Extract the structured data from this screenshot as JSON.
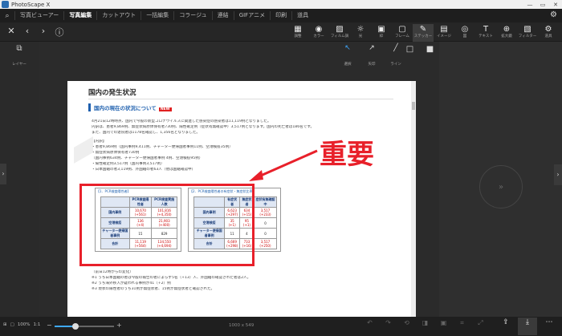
{
  "app": {
    "title": "PhotoScape X",
    "win_min": "—",
    "win_max": "▭",
    "win_close": "✕"
  },
  "tabs": [
    "写真ビューアー",
    "写真編集",
    "カットアウト",
    "一括編集",
    "コラージュ",
    "連結",
    "GIFアニメ",
    "印刷",
    "道具"
  ],
  "active_tab": 1,
  "nav": {
    "close": "✕",
    "back": "‹",
    "forward": "›",
    "info": "ⓘ"
  },
  "tools": [
    {
      "label": "調整",
      "icon": "adjust-icon",
      "glyph": "▦"
    },
    {
      "label": "カラー",
      "icon": "color-icon",
      "glyph": "◉"
    },
    {
      "label": "フィルム調",
      "icon": "film-icon",
      "glyph": "▨"
    },
    {
      "label": "光",
      "icon": "light-icon",
      "glyph": "☼"
    },
    {
      "label": "枠",
      "icon": "frame-icon",
      "glyph": "▣"
    },
    {
      "label": "フレーム",
      "icon": "frame2-icon",
      "glyph": "▢"
    },
    {
      "label": "ステッカー",
      "icon": "sticker-icon",
      "glyph": "✎"
    },
    {
      "label": "イメージ",
      "icon": "image-icon",
      "glyph": "▤"
    },
    {
      "label": "図",
      "icon": "shape-icon",
      "glyph": "◎"
    },
    {
      "label": "テキスト",
      "icon": "text-icon",
      "glyph": "T"
    },
    {
      "label": "拡大鏡",
      "icon": "magnifier-icon",
      "glyph": "⊕"
    },
    {
      "label": "フィルター",
      "icon": "filter-icon",
      "glyph": "▧"
    },
    {
      "label": "道具",
      "icon": "tools-icon",
      "glyph": "⚙"
    }
  ],
  "active_tool": 6,
  "layer_label": "レイヤー",
  "subtools": [
    {
      "label": "選択",
      "glyph": "↖"
    },
    {
      "label": "矢印",
      "glyph": "↗"
    },
    {
      "label": "ライン",
      "glyph": "╱"
    }
  ],
  "shapes": [
    "□",
    "■",
    "▢",
    "▣",
    "○",
    "●",
    "☆"
  ],
  "document": {
    "heading": "国内の発生状況",
    "subheading": "国内の現在の状況について",
    "new_badge": "NEW",
    "lines": [
      "4月21日12時時点、国内で今般の新型コロナウイルスに関連した感染症の感染者は11,119例となりました。",
      "内訳は、患者9,869例、無症状病原体保有者730例、陽性確定例（症状有無確認中）3,517例となります。国内の死亡者は186名です。",
      "また、国内での退院者は1178名確認し、1,356名となりました。",
      "【内訳】",
      "・患者9,869例（国内事例9,411例、チャーター便帰国者事例11例、空港検疫35例）",
      "・無症状病原体保有者730例",
      "（国内事例634例、チャーター便帰国者事例 4例、空港検疫95例）",
      "・陽性確定例3,517例（国内事例3,517例）",
      "・日本国籍の者3,119例、外国籍の者63人（他は国籍確認中）"
    ],
    "bottom_lines": [
      "（前日12時からの変化）",
      "※1 うち日本国籍の者は今般の報告の者によらず5名（+13）人、外国籍の確認された者は2人。",
      "※2 うち海外移入が疑われる事例が41（+2）例",
      "※3 現状の陽性者のうち31例が無症状者、15例が無症状者と確認された。"
    ],
    "table1": {
      "caption": "【1．PCR検査陽性者】",
      "headers": [
        "",
        "PCR検査陽性者",
        "PCR検査実施人数"
      ],
      "rows": [
        [
          "国内事例",
          "10,670\n(+561)",
          "101,816\n(+4,350)"
        ],
        [
          "空港検疫",
          "136\n(+4)",
          "21,903\n(+400)"
        ],
        [
          "チャーター便帰国者事例",
          "15",
          "829"
        ],
        [
          "合計",
          "11,119\n(+564)",
          "134,550\n(+4,694)"
        ]
      ]
    },
    "table2": {
      "caption": "【2．PCR検査陽性者の有症状・無症状比率】",
      "headers": [
        "",
        "有症状者",
        "無症状者",
        "症状有無確認中"
      ],
      "rows": [
        [
          "国内事例",
          "6,623\n(+297)",
          "634\n(+15)",
          "3,517\n(+233)"
        ],
        [
          "空港検疫",
          "35\n(+1)",
          "95\n(+1)",
          "0"
        ],
        [
          "チャーター便帰国者事例",
          "11",
          "4",
          "0"
        ],
        [
          "合計",
          "6,669\n(+298)",
          "733\n(+16)",
          "3,517\n(+250)"
        ]
      ]
    }
  },
  "annotation": {
    "text": "重要"
  },
  "status": {
    "zoom": "100%",
    "ratio": "1:1",
    "zoom_minus": "−",
    "zoom_plus": "+",
    "zoom_level": 0.35,
    "image_size": "1000 x 549"
  },
  "bottom_tools": [
    {
      "label": "元に戻す",
      "glyph": "↶"
    },
    {
      "label": "やり直し",
      "glyph": "↷"
    },
    {
      "label": "元に戻す",
      "glyph": "⟲"
    },
    {
      "label": "比較",
      "glyph": "◨"
    },
    {
      "label": "保存",
      "glyph": "▣"
    },
    {
      "label": "切り取り",
      "glyph": "⌗"
    },
    {
      "label": "サイズ",
      "glyph": "⤢"
    }
  ],
  "right_actions": [
    {
      "label": "開く",
      "glyph": "⇪"
    },
    {
      "label": "保存",
      "glyph": "⤓"
    },
    {
      "label": "その他",
      "glyph": "⋯"
    }
  ],
  "colors": {
    "accent": "#3fa9ff",
    "highlight": "#e8202a"
  }
}
